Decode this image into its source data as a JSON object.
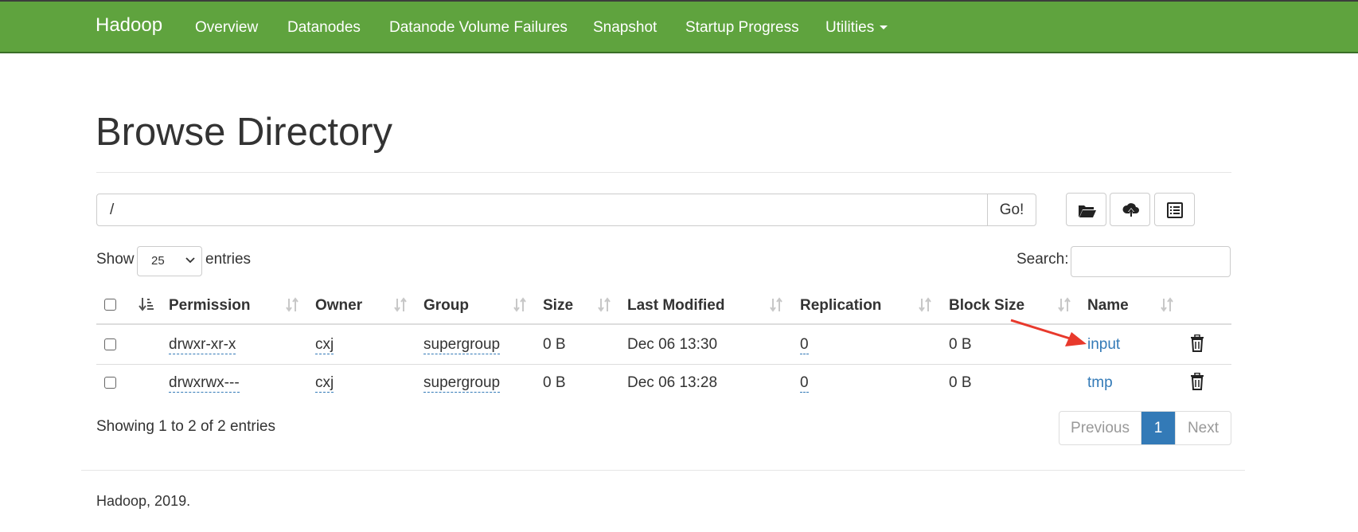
{
  "navbar": {
    "brand": "Hadoop",
    "items": [
      "Overview",
      "Datanodes",
      "Datanode Volume Failures",
      "Snapshot",
      "Startup Progress",
      "Utilities"
    ],
    "color": "#5fa33e"
  },
  "page": {
    "title": "Browse Directory"
  },
  "path_bar": {
    "value": "/",
    "go_label": "Go!"
  },
  "toolbar": {
    "icons": [
      "folder-open-icon",
      "cloud-upload-icon",
      "list-alt-icon"
    ]
  },
  "table_controls": {
    "show_label": "Show",
    "entries_value": "25",
    "entries_label": "entries",
    "search_label": "Search:"
  },
  "table": {
    "columns": [
      "Permission",
      "Owner",
      "Group",
      "Size",
      "Last Modified",
      "Replication",
      "Block Size",
      "Name"
    ],
    "rows": [
      {
        "permission": "drwxr-xr-x",
        "owner": "cxj",
        "group": "supergroup",
        "size": "0 B",
        "last_modified": "Dec 06 13:30",
        "replication": "0",
        "block_size": "0 B",
        "name": "input"
      },
      {
        "permission": "drwxrwx---",
        "owner": "cxj",
        "group": "supergroup",
        "size": "0 B",
        "last_modified": "Dec 06 13:28",
        "replication": "0",
        "block_size": "0 B",
        "name": "tmp"
      }
    ]
  },
  "info": "Showing 1 to 2 of 2 entries",
  "pagination": {
    "previous": "Previous",
    "current": "1",
    "next": "Next"
  },
  "footer": "Hadoop, 2019.",
  "annotation": {
    "arrow_color": "#e8392c"
  }
}
